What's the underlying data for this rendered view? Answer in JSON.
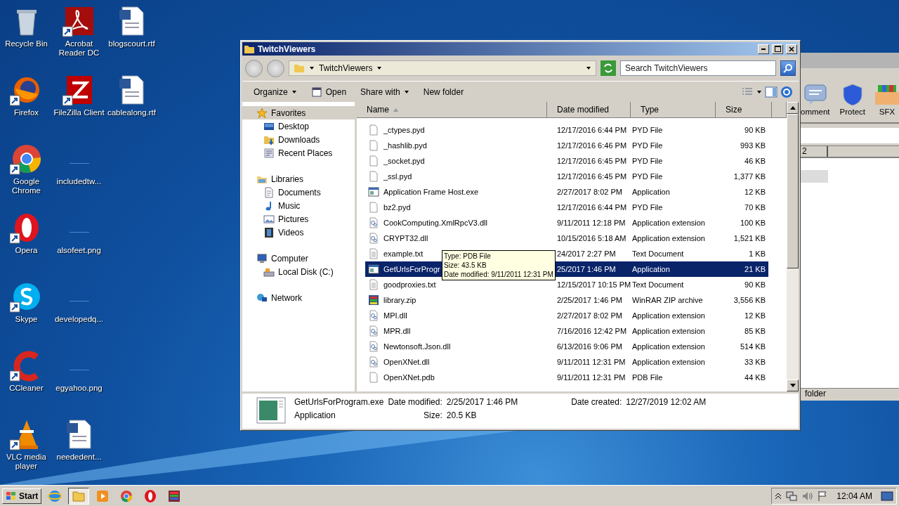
{
  "desktop_icons": [
    {
      "label": "Recycle Bin",
      "kind": "recycle",
      "shortcut": false
    },
    {
      "label": "Firefox",
      "kind": "firefox",
      "shortcut": true
    },
    {
      "label": "Google Chrome",
      "kind": "chrome",
      "shortcut": true
    },
    {
      "label": "Opera",
      "kind": "opera",
      "shortcut": true
    },
    {
      "label": "Skype",
      "kind": "skype",
      "shortcut": true
    },
    {
      "label": "CCleaner",
      "kind": "ccleaner",
      "shortcut": true
    },
    {
      "label": "VLC media player",
      "kind": "vlc",
      "shortcut": true
    },
    {
      "label": "Acrobat Reader DC",
      "kind": "pdf",
      "shortcut": true
    },
    {
      "label": "FileZilla Client",
      "kind": "filezilla",
      "shortcut": true
    },
    {
      "label": "includedtw...",
      "kind": "blank",
      "shortcut": false
    },
    {
      "label": "alsofeet.png",
      "kind": "blank",
      "shortcut": false
    },
    {
      "label": "developedq...",
      "kind": "blank",
      "shortcut": false
    },
    {
      "label": "egyahoo.png",
      "kind": "blank",
      "shortcut": false
    },
    {
      "label": "neededent...",
      "kind": "word",
      "shortcut": false
    },
    {
      "label": "blogscourt.rtf",
      "kind": "word",
      "shortcut": false
    },
    {
      "label": "cablealong.rtf",
      "kind": "word",
      "shortcut": false
    }
  ],
  "background_window": {
    "tools": [
      {
        "label": "omment",
        "kind": "comment"
      },
      {
        "label": "Protect",
        "kind": "shield"
      },
      {
        "label": "SFX",
        "kind": "box"
      }
    ],
    "column": "2",
    "status": "folder"
  },
  "explorer": {
    "title": "TwitchViewers",
    "breadcrumb": "TwitchViewers",
    "search": {
      "placeholder": "Search TwitchViewers"
    },
    "toolbar": [
      {
        "label": "Organize",
        "kind": "dropdown"
      },
      {
        "label": "Open",
        "kind": "icon"
      },
      {
        "label": "Share with",
        "kind": "dropdown"
      },
      {
        "label": "New folder",
        "kind": "plain"
      }
    ],
    "nav": [
      {
        "label": "Favorites",
        "kind": "star",
        "selected": true,
        "children": [
          {
            "label": "Desktop",
            "kind": "desktop",
            "selected": false
          },
          {
            "label": "Downloads",
            "kind": "downloads",
            "selected": false
          },
          {
            "label": "Recent Places",
            "kind": "recent",
            "selected": false
          }
        ]
      },
      {
        "label": "Libraries",
        "kind": "library",
        "selected": false,
        "children": [
          {
            "label": "Documents",
            "kind": "documents",
            "selected": false
          },
          {
            "label": "Music",
            "kind": "music",
            "selected": false
          },
          {
            "label": "Pictures",
            "kind": "pictures",
            "selected": false
          },
          {
            "label": "Videos",
            "kind": "videos",
            "selected": false
          }
        ]
      },
      {
        "label": "Computer",
        "kind": "computer",
        "selected": false,
        "children": [
          {
            "label": "Local Disk (C:)",
            "kind": "disk",
            "selected": false
          }
        ]
      },
      {
        "label": "Network",
        "kind": "network",
        "selected": false
      }
    ],
    "columns": [
      {
        "label": "Name",
        "sorted": true
      },
      {
        "label": "Date modified",
        "sorted": false
      },
      {
        "label": "Type",
        "sorted": false
      },
      {
        "label": "Size",
        "sorted": false
      }
    ],
    "files": [
      {
        "name": "_ctypes.pyd",
        "date": "12/17/2016 6:44 PM",
        "type": "PYD File",
        "size": "90 KB",
        "kind": "blank",
        "selected": false
      },
      {
        "name": "_hashlib.pyd",
        "date": "12/17/2016 6:46 PM",
        "type": "PYD File",
        "size": "993 KB",
        "kind": "blank",
        "selected": false
      },
      {
        "name": "_socket.pyd",
        "date": "12/17/2016 6:45 PM",
        "type": "PYD File",
        "size": "46 KB",
        "kind": "blank",
        "selected": false
      },
      {
        "name": "_ssl.pyd",
        "date": "12/17/2016 6:45 PM",
        "type": "PYD File",
        "size": "1,377 KB",
        "kind": "blank",
        "selected": false
      },
      {
        "name": "Application Frame Host.exe",
        "date": "2/27/2017 8:02 PM",
        "type": "Application",
        "size": "12 KB",
        "kind": "app",
        "selected": false
      },
      {
        "name": "bz2.pyd",
        "date": "12/17/2016 6:44 PM",
        "type": "PYD File",
        "size": "70 KB",
        "kind": "blank",
        "selected": false
      },
      {
        "name": "CookComputing.XmlRpcV3.dll",
        "date": "9/11/2011 12:18 PM",
        "type": "Application extension",
        "size": "100 KB",
        "kind": "dll",
        "selected": false
      },
      {
        "name": "CRYPT32.dll",
        "date": "10/15/2016 5:18 AM",
        "type": "Application extension",
        "size": "1,521 KB",
        "kind": "dll",
        "selected": false
      },
      {
        "name": "example.txt",
        "date": "24/2017 2:27 PM",
        "type": "Text Document",
        "size": "1 KB",
        "kind": "txt",
        "selected": false
      },
      {
        "name": "GetUrlsForProgr",
        "date": "25/2017 1:46 PM",
        "type": "Application",
        "size": "21 KB",
        "kind": "app",
        "selected": true
      },
      {
        "name": "goodproxies.txt",
        "date": "12/15/2017 10:15 PM",
        "type": "Text Document",
        "size": "90 KB",
        "kind": "txt",
        "selected": false
      },
      {
        "name": "library.zip",
        "date": "2/25/2017 1:46 PM",
        "type": "WinRAR ZIP archive",
        "size": "3,556 KB",
        "kind": "zip",
        "selected": false
      },
      {
        "name": "MPI.dll",
        "date": "2/27/2017 8:02 PM",
        "type": "Application extension",
        "size": "12 KB",
        "kind": "dll",
        "selected": false
      },
      {
        "name": "MPR.dll",
        "date": "7/16/2016 12:42 PM",
        "type": "Application extension",
        "size": "85 KB",
        "kind": "dll",
        "selected": false
      },
      {
        "name": "Newtonsoft.Json.dll",
        "date": "6/13/2016 9:06 PM",
        "type": "Application extension",
        "size": "514 KB",
        "kind": "dll",
        "selected": false
      },
      {
        "name": "OpenXNet.dll",
        "date": "9/11/2011 12:31 PM",
        "type": "Application extension",
        "size": "33 KB",
        "kind": "dll",
        "selected": false
      },
      {
        "name": "OpenXNet.pdb",
        "date": "9/11/2011 12:31 PM",
        "type": "PDB File",
        "size": "44 KB",
        "kind": "blank",
        "selected": false
      }
    ],
    "tooltip": [
      "Type: PDB File",
      "Size: 43.5 KB",
      "Date modified: 9/11/2011 12:31 PM"
    ],
    "details": {
      "name": "GetUrlsForProgram.exe",
      "type": "Application",
      "modified_label": "Date modified:",
      "modified": "2/25/2017 1:46 PM",
      "size_label": "Size:",
      "size": "20.5 KB",
      "created_label": "Date created:",
      "created": "12/27/2019 12:02 AM"
    }
  },
  "taskbar": {
    "start": "Start",
    "apps": [
      {
        "kind": "ie",
        "active": false
      },
      {
        "kind": "explorer",
        "active": true
      },
      {
        "kind": "media",
        "active": false
      },
      {
        "kind": "chrome",
        "active": false
      },
      {
        "kind": "opera",
        "active": false
      },
      {
        "kind": "winrar",
        "active": false
      }
    ],
    "clock": "12:04 AM"
  }
}
